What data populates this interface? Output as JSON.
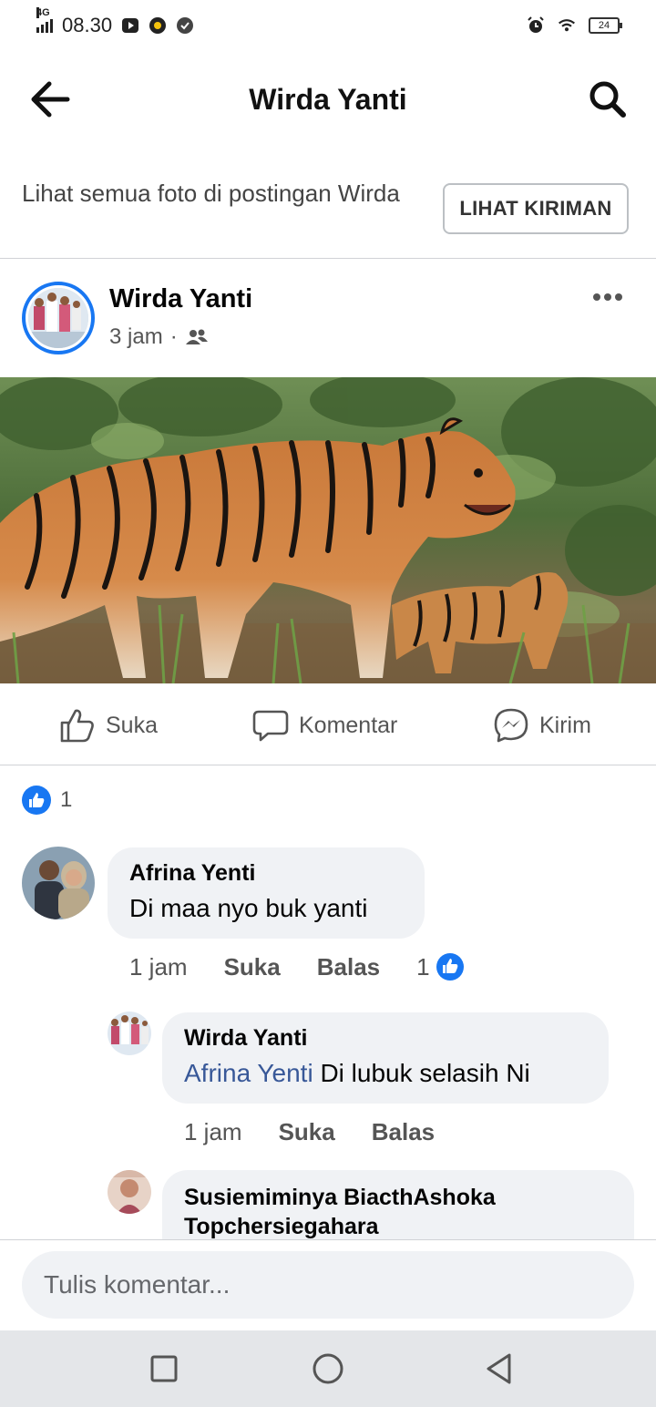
{
  "status_bar": {
    "network": "4G",
    "time": "08.30",
    "battery": "24"
  },
  "header": {
    "title": "Wirda Yanti"
  },
  "banner": {
    "text": "Lihat semua foto di postingan Wirda",
    "button": "LIHAT KIRIMAN"
  },
  "post": {
    "author": "Wirda Yanti",
    "time": "3 jam",
    "separator": "·",
    "audience_icon": "friends-icon",
    "photo_description_icon": "tiger-photo"
  },
  "actions": {
    "like": "Suka",
    "comment": "Komentar",
    "send": "Kirim"
  },
  "reactions": {
    "like_count": "1"
  },
  "comments": [
    {
      "author": "Afrina Yenti",
      "text": "Di maa nyo buk yanti",
      "time": "1 jam",
      "like": "Suka",
      "reply": "Balas",
      "reaction_count": "1"
    },
    {
      "author": "Wirda Yanti",
      "mention": "Afrina Yenti",
      "text": "Di lubuk selasih Ni",
      "time": "1 jam",
      "like": "Suka",
      "reply": "Balas"
    },
    {
      "author_line1": "Susiemiminya BiacthAshoka",
      "author_line2": "Topchersiegahara"
    }
  ],
  "composer": {
    "placeholder": "Tulis komentar..."
  },
  "colors": {
    "accent": "#1877f2",
    "bubble": "#f0f2f5",
    "mention": "#385898"
  }
}
